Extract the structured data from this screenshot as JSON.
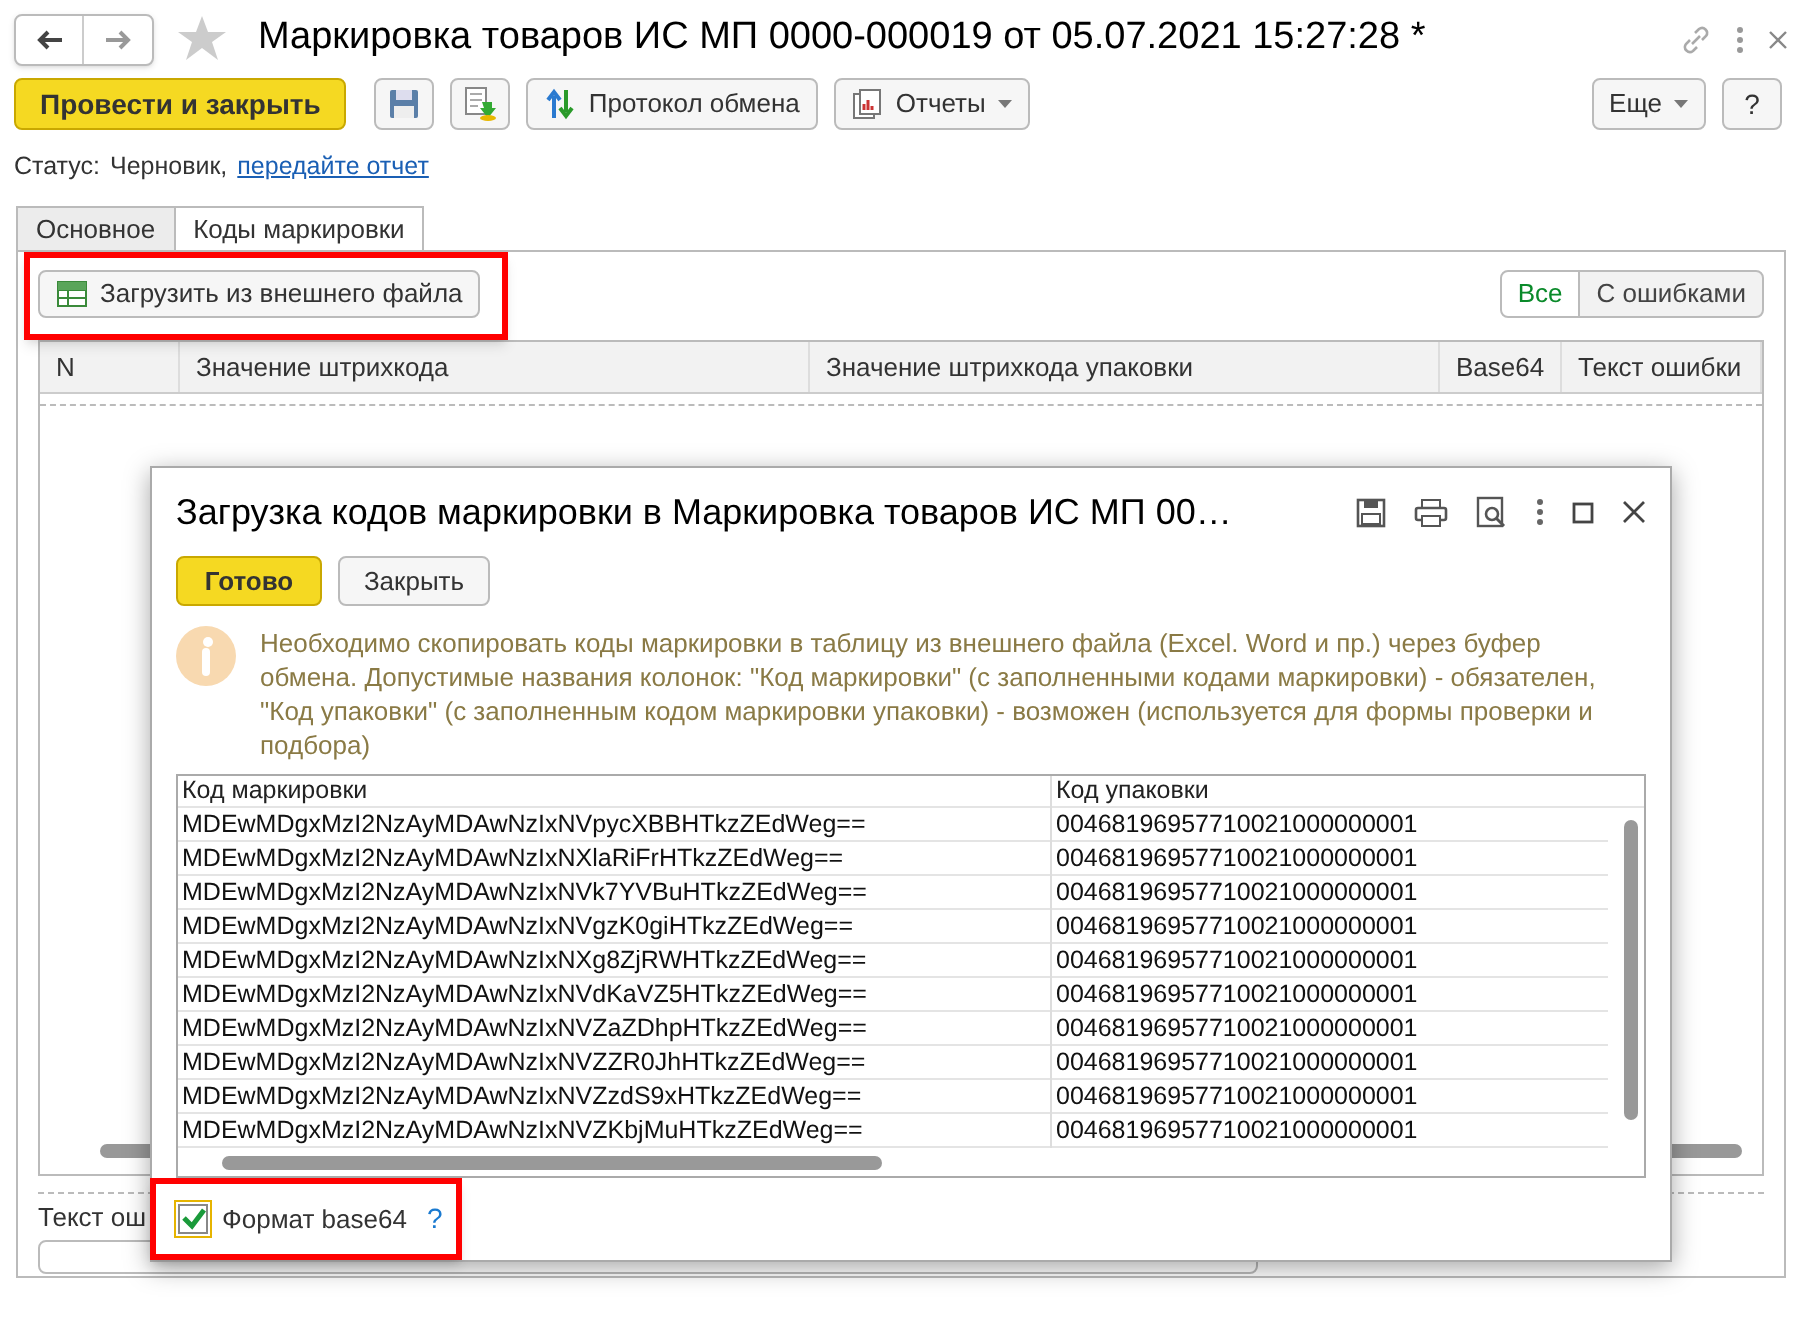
{
  "window": {
    "title": "Маркировка товаров ИС МП 0000-000019 от 05.07.2021 15:27:28 *"
  },
  "toolbar": {
    "primary": "Провести и закрыть",
    "exchange": "Протокол обмена",
    "reports": "Отчеты",
    "more": "Еще",
    "help": "?"
  },
  "status": {
    "label": "Статус:",
    "value": "Черновик,",
    "link": "передайте отчет"
  },
  "tabs": [
    {
      "label": "Основное",
      "selected": false
    },
    {
      "label": "Коды маркировки",
      "selected": true
    }
  ],
  "load_button": "Загрузить из внешнего файла",
  "filters": [
    {
      "label": "Все",
      "selected": true
    },
    {
      "label": "С ошибками",
      "selected": false
    }
  ],
  "table": {
    "columns": [
      "N",
      "Значение штрихкода",
      "Значение штрихкода упаковки",
      "Base64",
      "Текст ошибки"
    ]
  },
  "error_text_label": "Текст ош",
  "dialog": {
    "title": "Загрузка кодов маркировки в Маркировка товаров ИС МП 00…",
    "buttons": [
      "Готово",
      "Закрыть"
    ],
    "info": "Необходимо скопировать коды маркировки в таблицу из внешнего файла (Excel. Word и пр.) через буфер обмена. Допустимые названия колонок: \"Код маркировки\" (с заполненными кодами маркировки) - обязателен, \"Код упаковки\" (с заполненным кодом маркировки упаковки) - возможен (используется для формы проверки и подбора)",
    "columns": [
      "Код маркировки",
      "Код упаковки"
    ],
    "rows": [
      [
        "MDEwMDgxMzI2NzAyMDAwNzIxNVpycXBBHTkzZEdWeg==",
        "0046819695771002100000000​1"
      ],
      [
        "MDEwMDgxMzI2NzAyMDAwNzIxNXlaRiFrHTkzZEdWeg==",
        "00468196957710021000000001"
      ],
      [
        "MDEwMDgxMzI2NzAyMDAwNzIxNVk7YVBuHTkzZEdWeg==",
        "00468196957710021000000001"
      ],
      [
        "MDEwMDgxMzI2NzAyMDAwNzIxNVgzK0giHTkzZEdWeg==",
        "00468196957710021000000001"
      ],
      [
        "MDEwMDgxMzI2NzAyMDAwNzIxNXg8ZjRWHTkzZEdWeg==",
        "00468196957710021000000001"
      ],
      [
        "MDEwMDgxMzI2NzAyMDAwNzIxNVdKaVZ5HTkzZEdWeg==",
        "00468196957710021000000001"
      ],
      [
        "MDEwMDgxMzI2NzAyMDAwNzIxNVZaZDhpHTkzZEdWeg==",
        "00468196957710021000000001"
      ],
      [
        "MDEwMDgxMzI2NzAyMDAwNzIxNVZZR0JhHTkzZEdWeg==",
        "00468196957710021000000001"
      ],
      [
        "MDEwMDgxMzI2NzAyMDAwNzIxNVZzdS9xHTkzZEdWeg==",
        "00468196957710021000000001"
      ],
      [
        "MDEwMDgxMzI2NzAyMDAwNzIxNVZKbjMuHTkzZEdWeg==",
        "00468196957710021000000001"
      ]
    ],
    "checkbox": {
      "label": "Формат base64",
      "checked": true
    },
    "help": "?"
  }
}
